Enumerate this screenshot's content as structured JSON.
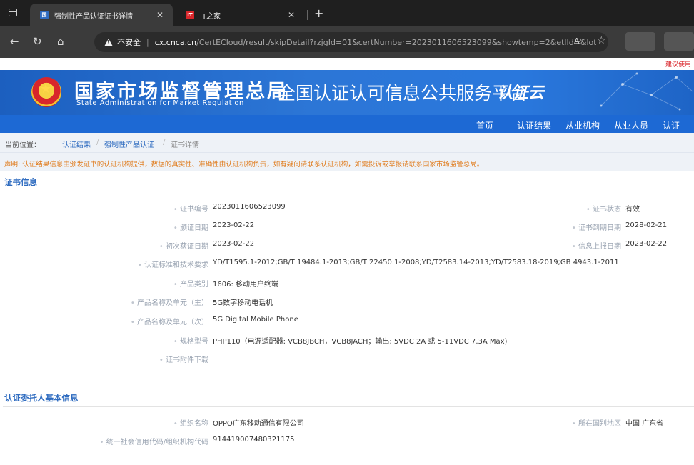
{
  "browser": {
    "tabs": [
      {
        "title": "强制性产品认证证书详情",
        "active": true
      },
      {
        "title": "IT之家",
        "active": false
      }
    ],
    "address": {
      "security_label": "不安全",
      "host": "cx.cnca.cn",
      "path": "/CertECloud/result/skipDetail?rzjgId=01&certNumber=2023011606523099&showtemp=2&etlId=&lot_number=..."
    },
    "read_aloud": "A⁾"
  },
  "page": {
    "top_note": "建议使用",
    "banner": {
      "agency_cn": "国家市场监督管理总局",
      "agency_en": "State Administration  for  Market Regulation",
      "platform": "全国认证认可信息公共服务平台",
      "platform_logo": "认证云"
    },
    "nav": [
      "首页",
      "认证结果",
      "从业机构",
      "从业人员",
      "认证"
    ],
    "breadcrumb": {
      "label": "当前位置：",
      "items": [
        "认证结果",
        "强制性产品认证",
        "证书详情"
      ],
      "separator": "/"
    },
    "disclaimer": "声明: 认证结果信息由颁发证书的认证机构提供，数据的真实性、准确性由认证机构负责，如有疑问请联系认证机构，如需投诉或举报请联系国家市场监管总局。",
    "cert_section": {
      "title": "证书信息",
      "left": [
        {
          "label": "证书编号",
          "value": "2023011606523099"
        },
        {
          "label": "颁证日期",
          "value": "2023-02-22"
        },
        {
          "label": "初次获证日期",
          "value": "2023-02-22"
        },
        {
          "label": "认证标准和技术要求",
          "value": "YD/T1595.1-2012;GB/T 19484.1-2013;GB/T 22450.1-2008;YD/T2583.14-2013;YD/T2583.18-2019;GB 4943.1-2011"
        },
        {
          "label": "产品类别",
          "value": "1606: 移动用户终端"
        },
        {
          "label": "产品名称及单元（主）",
          "value": "5G数字移动电话机"
        },
        {
          "label": "产品名称及单元（次）",
          "value": "5G Digital Mobile Phone"
        },
        {
          "label": "规格型号",
          "value": "PHP110（电源适配器: VCB8JBCH，VCB8JACH；输出: 5VDC 2A 或 5-11VDC 7.3A Max)"
        },
        {
          "label": "证书附件下载",
          "value": ""
        }
      ],
      "right": [
        {
          "label": "证书状态",
          "value": "有效"
        },
        {
          "label": "证书到期日期",
          "value": "2028-02-21"
        },
        {
          "label": "信息上报日期",
          "value": "2023-02-22"
        }
      ]
    },
    "client_section": {
      "title": "认证委托人基本信息",
      "left": [
        {
          "label": "组织名称",
          "value": "OPPO广东移动通信有限公司"
        },
        {
          "label": "统一社会信用代码/组织机构代码",
          "value": "914419007480321175"
        }
      ],
      "right": [
        {
          "label": "所在国别地区",
          "value": "中国 广东省"
        }
      ]
    }
  },
  "colors": {
    "banner_blue": "#2a78dd",
    "nav_blue": "#1d69d4",
    "link_blue": "#2f6cc0",
    "disclaimer_orange": "#e07a1a",
    "note_red": "#d9262b"
  }
}
